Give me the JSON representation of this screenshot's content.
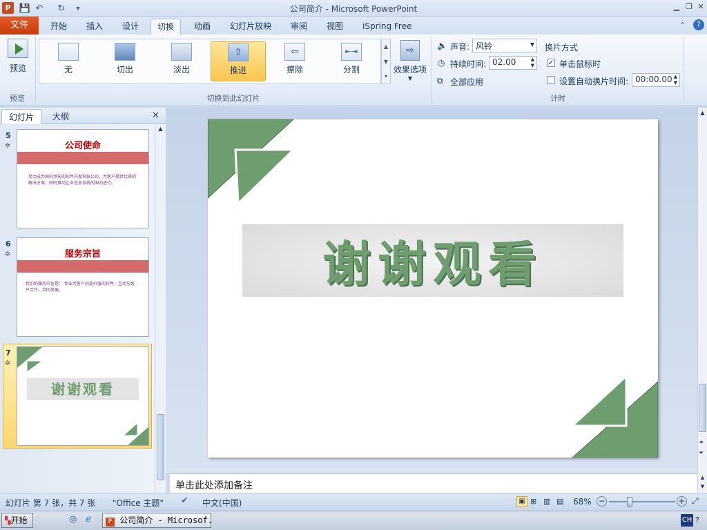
{
  "window": {
    "title": "公司简介 - Microsoft PowerPoint",
    "app_icon_letter": "P",
    "undo_glyph": "↶",
    "redo_glyph": "↻",
    "save_glyph": "💾",
    "qat_more_glyph": "▾"
  },
  "ribbon_tabs": {
    "file": "文件",
    "tabs": [
      "开始",
      "插入",
      "设计",
      "切换",
      "动画",
      "幻灯片放映",
      "审阅",
      "视图",
      "iSpring Free"
    ],
    "active_index": 3
  },
  "ribbon": {
    "preview_label": "预览",
    "preview_group": "预览",
    "transitions": [
      "无",
      "切出",
      "淡出",
      "推进",
      "擦除",
      "分割"
    ],
    "selected_transition_index": 3,
    "effect_options": "效果选项",
    "transition_group": "切换到此幻灯片",
    "sound_label": "声音:",
    "sound_value": "风铃",
    "duration_label": "持续时间:",
    "duration_value": "02.00",
    "apply_all": "全部应用",
    "advance_title": "换片方式",
    "on_click_label": "单击鼠标时",
    "on_click_checked": true,
    "after_label": "设置自动换片时间:",
    "after_checked": false,
    "after_value": "00:00.00",
    "timing_group": "计时"
  },
  "left_pane": {
    "tab_slides": "幻灯片",
    "tab_outline": "大纲",
    "close": "✕",
    "thumbnails": [
      {
        "number": "5",
        "title": "公司使命",
        "body": "努力成为国内领先的软件开发科技公司，为客户提供优质的解决方案，同时推动企业信息系统的国内进行。"
      },
      {
        "number": "6",
        "title": "服务宗旨",
        "body": "我们的服务宗旨是：  专业为客户创造价值的软件，互动与客户合作，共同发展。"
      },
      {
        "number": "7",
        "title": "谢谢观看",
        "body": ""
      }
    ],
    "selected_index": 2
  },
  "slide": {
    "text": "谢谢观看",
    "accent_color": "#6e9e70"
  },
  "notes": {
    "placeholder": "单击此处添加备注"
  },
  "status": {
    "slide_info": "幻灯片 第 7 张，共 7 张",
    "theme": "\"Office 主题\"",
    "language": "中文(中国)",
    "zoom": "68%"
  },
  "taskbar": {
    "start": "开始",
    "item": "公司简介 - Microsof...",
    "ime": "CH"
  }
}
